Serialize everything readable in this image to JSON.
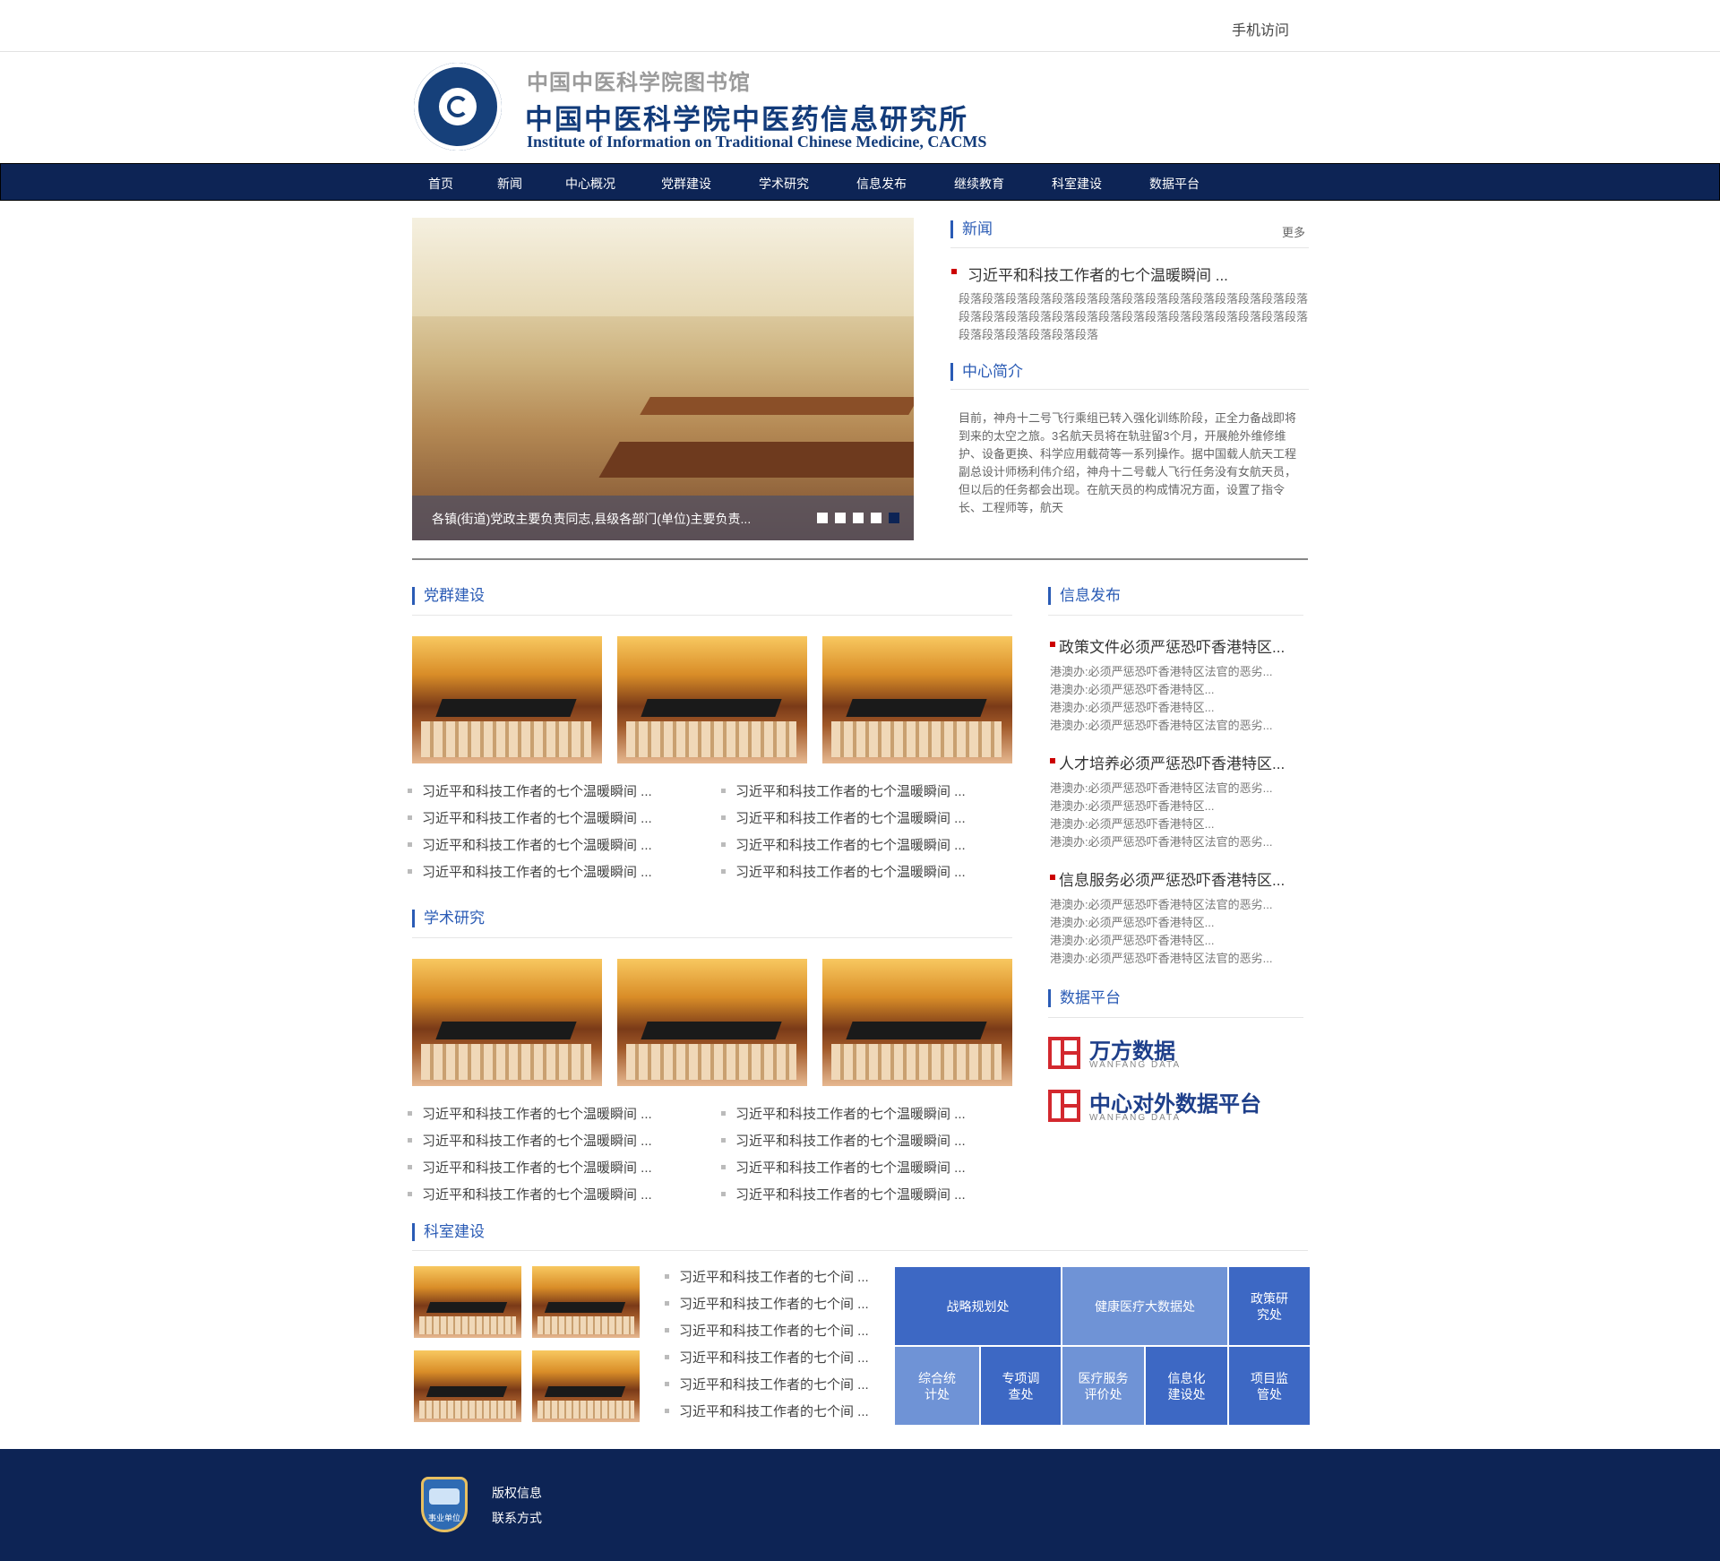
{
  "header": {
    "mobile_link": "手机访问",
    "library_name": "中国中医科学院图书馆",
    "institute_cn": "中国中医科学院中医药信息研究所",
    "institute_en": "Institute of Information on Traditional Chinese Medicine, CACMS"
  },
  "nav": {
    "items": [
      "首页",
      "新闻",
      "中心概况",
      "党群建设",
      "学术研究",
      "信息发布",
      "继续教育",
      "科室建设",
      "数据平台"
    ]
  },
  "slider": {
    "caption": "各镇(街道)党政主要负责同志,县级各部门(单位)主要负责...",
    "dots": 5,
    "active_dot": 5
  },
  "news": {
    "title": "新闻",
    "more": "更多",
    "headline": "习近平和科技工作者的七个温暖瞬间 ...",
    "body": "段落段落段落段落段落段落段落段落段落段落段落段落段落段落段落段落段落段落段落段落段落段落段落段落段落段落段落段落段落段落段落段落段落段落段落段落"
  },
  "intro": {
    "title": "中心简介",
    "body": "目前，神舟十二号飞行乘组已转入强化训练阶段，正全力备战即将到来的太空之旅。3名航天员将在轨驻留3个月，开展舱外维修维护、设备更换、科学应用载荷等一系列操作。据中国载人航天工程副总设计师杨利伟介绍，神舟十二号载人飞行任务没有女航天员，但以后的任务都会出现。在航天员的构成情况方面，设置了指令长、工程师等，航天"
  },
  "party": {
    "title": "党群建设",
    "list_left": [
      "习近平和科技工作者的七个温暖瞬间 ...",
      "习近平和科技工作者的七个温暖瞬间 ...",
      "习近平和科技工作者的七个温暖瞬间 ...",
      "习近平和科技工作者的七个温暖瞬间 ..."
    ],
    "list_right": [
      "习近平和科技工作者的七个温暖瞬间 ...",
      "习近平和科技工作者的七个温暖瞬间 ...",
      "习近平和科技工作者的七个温暖瞬间 ...",
      "习近平和科技工作者的七个温暖瞬间 ..."
    ]
  },
  "academic": {
    "title": "学术研究",
    "list_left": [
      "习近平和科技工作者的七个温暖瞬间 ...",
      "习近平和科技工作者的七个温暖瞬间 ...",
      "习近平和科技工作者的七个温暖瞬间 ...",
      "习近平和科技工作者的七个温暖瞬间 ..."
    ],
    "list_right": [
      "习近平和科技工作者的七个温暖瞬间 ...",
      "习近平和科技工作者的七个温暖瞬间 ...",
      "习近平和科技工作者的七个温暖瞬间 ...",
      "习近平和科技工作者的七个温暖瞬间 ..."
    ]
  },
  "info": {
    "title": "信息发布",
    "groups": [
      {
        "head": "政策文件必须严惩恐吓香港特区...",
        "lines": [
          "港澳办:必须严惩恐吓香港特区法官的恶劣...",
          "港澳办:必须严惩恐吓香港特区...",
          "港澳办:必须严惩恐吓香港特区...",
          "港澳办:必须严惩恐吓香港特区法官的恶劣..."
        ]
      },
      {
        "head": "人才培养必须严惩恐吓香港特区...",
        "lines": [
          "港澳办:必须严惩恐吓香港特区法官的恶劣...",
          "港澳办:必须严惩恐吓香港特区...",
          "港澳办:必须严惩恐吓香港特区...",
          "港澳办:必须严惩恐吓香港特区法官的恶劣..."
        ]
      },
      {
        "head": "信息服务必须严惩恐吓香港特区...",
        "lines": [
          "港澳办:必须严惩恐吓香港特区法官的恶劣...",
          "港澳办:必须严惩恐吓香港特区...",
          "港澳办:必须严惩恐吓香港特区...",
          "港澳办:必须严惩恐吓香港特区法官的恶劣..."
        ]
      }
    ]
  },
  "data_platform": {
    "title": "数据平台",
    "brands": [
      {
        "name": "万方数据",
        "sub": "WANFANG DATA"
      },
      {
        "name": "中心对外数据平台",
        "sub": "WANFANG DATA"
      }
    ]
  },
  "dept": {
    "title": "科室建设",
    "list": [
      "习近平和科技工作者的七个间 ...",
      "习近平和科技工作者的七个间 ...",
      "习近平和科技工作者的七个间 ...",
      "习近平和科技工作者的七个间 ...",
      "习近平和科技工作者的七个间 ...",
      "习近平和科技工作者的七个间 ..."
    ],
    "tiles": [
      "战略规划处",
      "健康医疗大数据处",
      "政策研究处",
      "综合统计处",
      "专项调查处",
      "医疗服务评价处",
      "信息化建设处",
      "项目监管处"
    ],
    "tile_colors": {
      "dark": "#3d68c4",
      "light": "#6f93d6"
    }
  },
  "footer": {
    "badge": "事业单位",
    "copyright": "版权信息",
    "contact": "联系方式"
  }
}
